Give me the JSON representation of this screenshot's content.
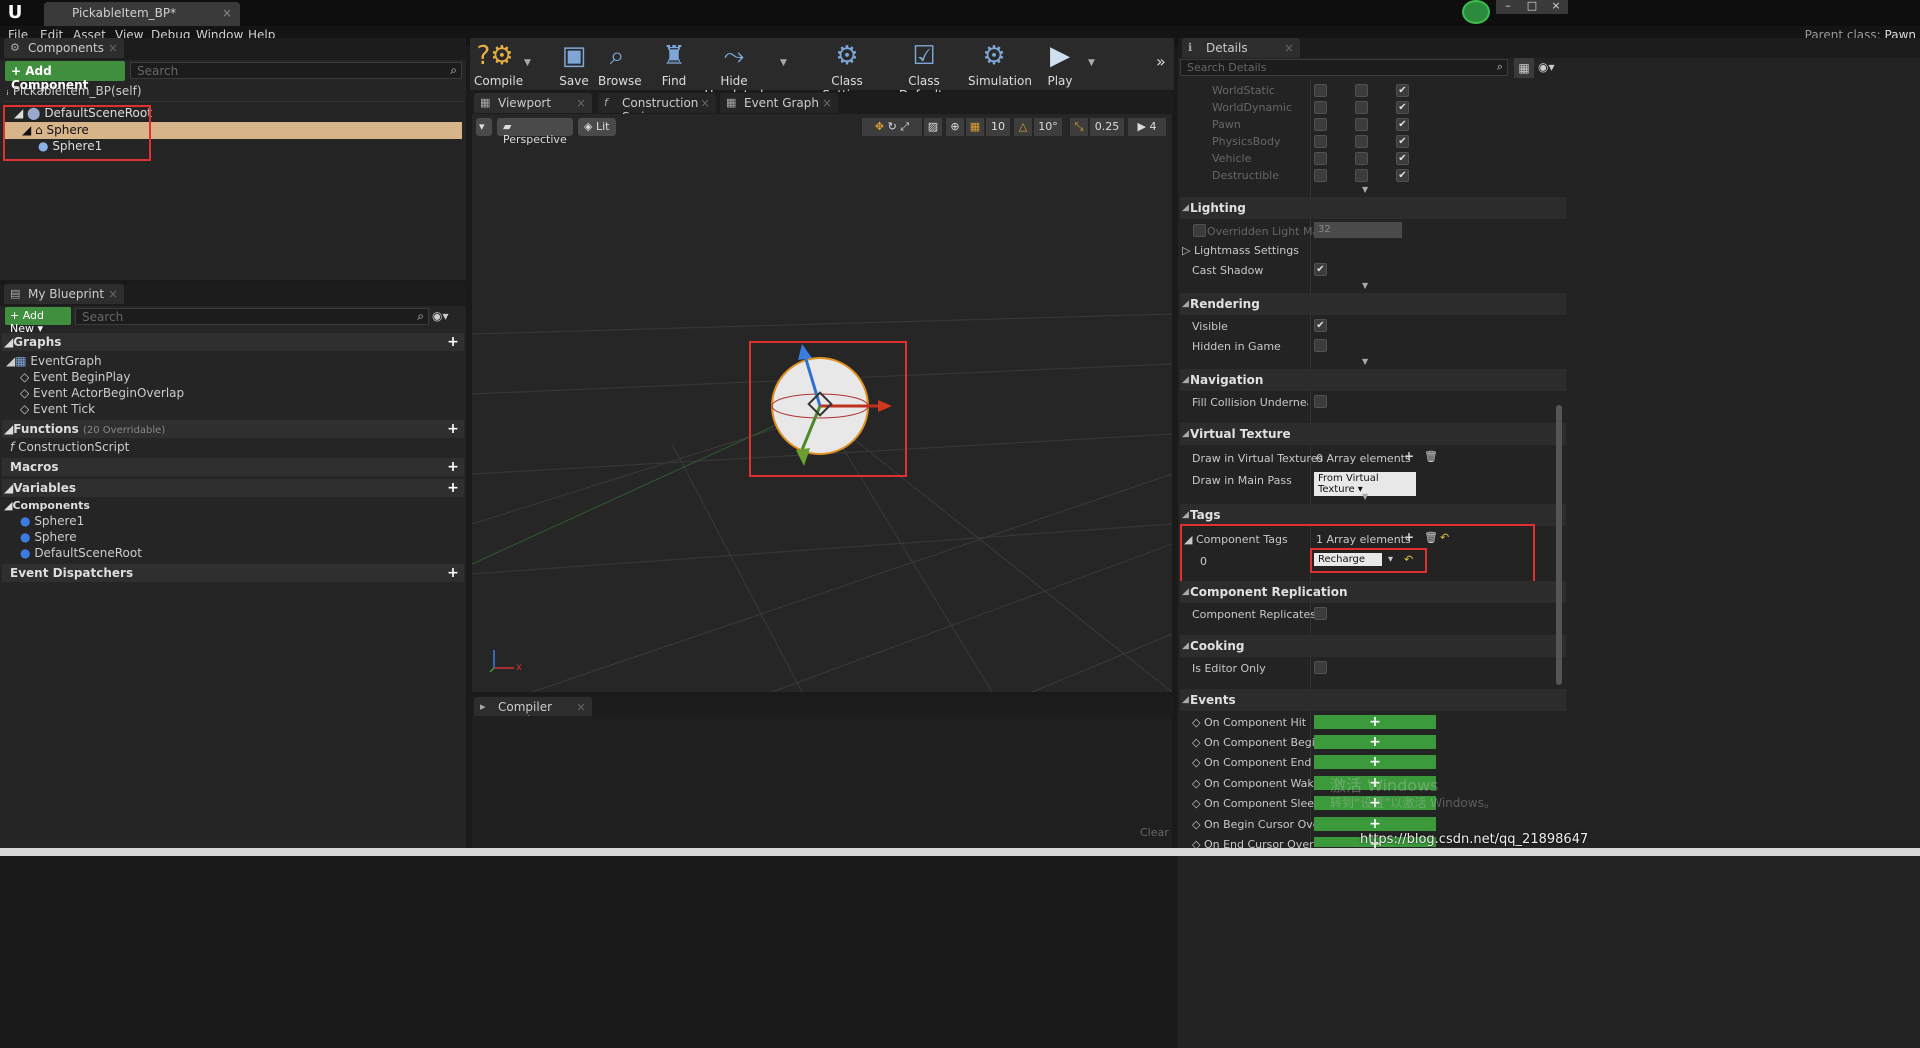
{
  "window": {
    "tab_title": "PickableItem_BP*",
    "parent_label": "Parent class:",
    "parent_value": "Pawn"
  },
  "menu": [
    "File",
    "Edit",
    "Asset",
    "View",
    "Debug",
    "Window",
    "Help"
  ],
  "components": {
    "tab": "Components",
    "add_button": "+ Add Component",
    "search_placeholder": "Search",
    "self_label": "PickableItem_BP(self)",
    "tree": [
      "DefaultSceneRoot",
      "Sphere",
      "Sphere1"
    ]
  },
  "my_blueprint": {
    "tab": "My Blueprint",
    "add_new": "Add New",
    "search_placeholder": "Search",
    "graphs": "Graphs",
    "event_graph": "EventGraph",
    "events": [
      "Event BeginPlay",
      "Event ActorBeginOverlap",
      "Event Tick"
    ],
    "functions": "Functions",
    "functions_note": "(20 Overridable)",
    "construction": "ConstructionScript",
    "macros": "Macros",
    "variables": "Variables",
    "components_label": "Components",
    "component_vars": [
      "Sphere1",
      "Sphere",
      "DefaultSceneRoot"
    ],
    "dispatchers": "Event Dispatchers"
  },
  "toolbar": [
    "Compile",
    "Save",
    "Browse",
    "Find",
    "Hide Unrelated",
    "Class Settings",
    "Class Defaults",
    "Simulation",
    "Play"
  ],
  "editor_tabs": [
    "Viewport",
    "Construction Scrip",
    "Event Graph"
  ],
  "viewport": {
    "perspective": "Perspective",
    "lit": "Lit",
    "grid": "10",
    "angle": "10°",
    "scale": "0.25",
    "cam": "4",
    "axis_x": "x"
  },
  "compiler": {
    "tab": "Compiler Results",
    "clear": "Clear"
  },
  "details": {
    "tab": "Details",
    "search_placeholder": "Search Details",
    "collision_rows": [
      "WorldStatic",
      "WorldDynamic",
      "Pawn",
      "PhysicsBody",
      "Vehicle",
      "Destructible"
    ],
    "lighting": "Lighting",
    "overridden_lm": "Overridden Light Map Re",
    "overridden_lm_value": "32",
    "lightmass": "Lightmass Settings",
    "cast_shadow": "Cast Shadow",
    "rendering": "Rendering",
    "visible": "Visible",
    "hidden_in_game": "Hidden in Game",
    "navigation": "Navigation",
    "fill_collision": "Fill Collision Underneath for N",
    "virtual_texture": "Virtual Texture",
    "draw_in_vt": "Draw in Virtual Textures",
    "draw_in_vt_value": "0 Array elements",
    "draw_main_pass": "Draw in Main Pass",
    "draw_main_pass_value": "From Virtual Texture",
    "tags": "Tags",
    "component_tags": "Component Tags",
    "component_tags_value": "1 Array elements",
    "tag_index": "0",
    "tag_value": "Recharge",
    "replication": "Component Replication",
    "replicates": "Component Replicates",
    "cooking": "Cooking",
    "editor_only": "Is Editor Only",
    "events": "Events",
    "event_rows": [
      "On Component Hit",
      "On Component Begin Ov",
      "On Component End Over",
      "On Component Wake",
      "On Component Sleep",
      "On Begin Cursor Over",
      "On End Cursor Over"
    ]
  },
  "watermark": {
    "line1": "激活 Windows",
    "line2": "转到“设置”以激活 Windows。",
    "url": "https://blog.csdn.net/qq_21898647"
  }
}
